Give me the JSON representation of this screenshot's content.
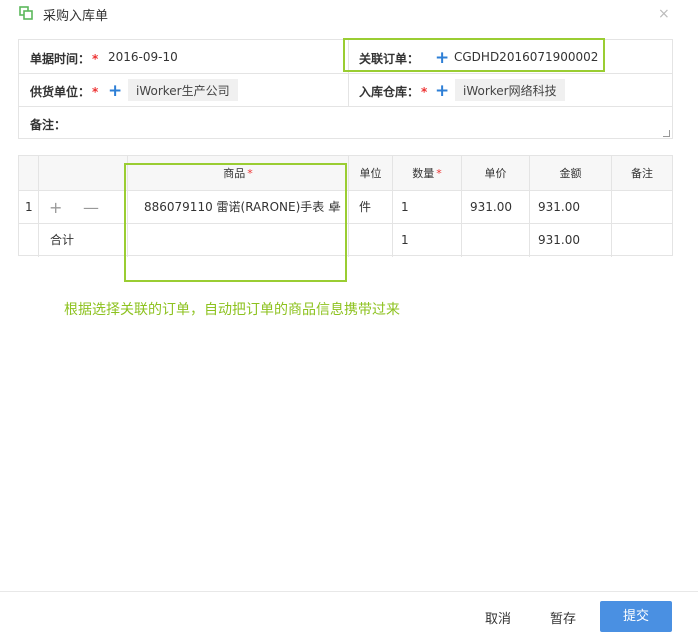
{
  "dialog": {
    "title": "采购入库单",
    "close_label": "×"
  },
  "form": {
    "date_label": "单据时间：",
    "date_value": "2016-09-10",
    "order_label": "关联订单：",
    "order_value": "CGDHD2016071900002",
    "supplier_label": "供货单位：",
    "supplier_value": "iWorker生产公司",
    "warehouse_label": "入库仓库：",
    "warehouse_value": "iWorker网络科技",
    "remark_label": "备注：",
    "required_mark": "*",
    "add_icon_glyph": "+"
  },
  "table": {
    "headers": {
      "product": "商品",
      "unit": "单位",
      "quantity": "数量",
      "price": "单价",
      "amount": "金额",
      "remark": "备注"
    },
    "rows": [
      {
        "index": "1",
        "add": "+",
        "remove": "—",
        "product": "886079110 雷诺(RARONE)手表 卓",
        "more": "···",
        "unit": "件",
        "quantity": "1",
        "price": "931.00",
        "amount": "931.00"
      }
    ],
    "total": {
      "label": "合计",
      "quantity": "1",
      "amount": "931.00"
    }
  },
  "annotation": "根据选择关联的订单，自动把订单的商品信息携带过来",
  "footer": {
    "cancel": "取消",
    "save_draft": "暂存",
    "submit": "提交"
  },
  "colors": {
    "accent": "#4a90e2",
    "highlight": "#9acd32",
    "required": "#e33333",
    "annotation": "#8dc21f"
  }
}
